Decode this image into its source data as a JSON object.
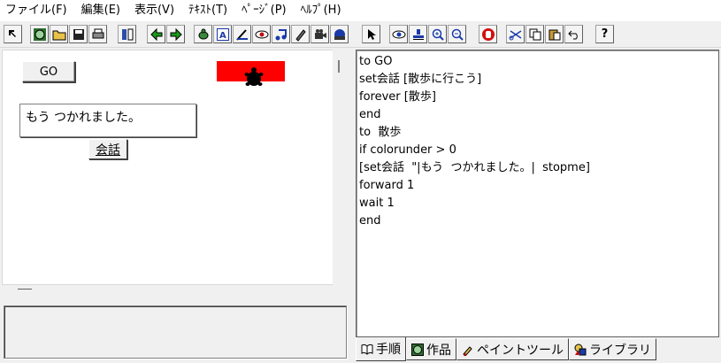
{
  "menu": {
    "items": [
      "ファイル(F)",
      "編集(E)",
      "表示(V)",
      "ﾃｷｽﾄ(T)",
      "ﾍﾟｰｼﾞ(P)",
      "ﾍﾙﾌﾟ(H)"
    ]
  },
  "toolbar": {
    "buttons": [
      {
        "name": "pointer-small-icon",
        "glyph": "⇱"
      },
      {
        "name": "globe-icon",
        "glyph": "◉"
      },
      {
        "name": "open-folder-icon",
        "glyph": "▭"
      },
      {
        "name": "save-disk-icon",
        "glyph": "▪"
      },
      {
        "name": "print-icon",
        "glyph": "▤"
      },
      {
        "name": "columns-icon",
        "glyph": "▥"
      },
      {
        "name": "arrow-left-icon",
        "glyph": "◀"
      },
      {
        "name": "arrow-right-icon",
        "glyph": "▶"
      },
      {
        "name": "turtle-icon",
        "glyph": "✿"
      },
      {
        "name": "text-box-icon",
        "glyph": "A"
      },
      {
        "name": "slider-icon",
        "glyph": "⚲"
      },
      {
        "name": "eye-button-icon",
        "glyph": "◉"
      },
      {
        "name": "music-note-icon",
        "glyph": "♫"
      },
      {
        "name": "pen-icon",
        "glyph": "✎"
      },
      {
        "name": "video-camera-icon",
        "glyph": "■"
      },
      {
        "name": "sphere-icon",
        "glyph": "●"
      },
      {
        "name": "select-arrow-icon",
        "glyph": "➚"
      },
      {
        "name": "eye-icon",
        "glyph": "◎"
      },
      {
        "name": "stamp-icon",
        "glyph": "⊥"
      },
      {
        "name": "zoom-in-icon",
        "glyph": "⊕"
      },
      {
        "name": "zoom-out-icon",
        "glyph": "⊖"
      },
      {
        "name": "stop-hand-icon",
        "glyph": "✋"
      },
      {
        "name": "cut-icon",
        "glyph": "✂"
      },
      {
        "name": "copy-icon",
        "glyph": "❐"
      },
      {
        "name": "paste-icon",
        "glyph": "▣"
      },
      {
        "name": "undo-icon",
        "glyph": "↶"
      },
      {
        "name": "help-icon",
        "glyph": "?"
      }
    ]
  },
  "canvas": {
    "go_button": "GO",
    "speech_text": "もう つかれました。",
    "kaiwa_button": "会話"
  },
  "code": {
    "lines": [
      "to GO",
      "set会話 [散歩に行こう]",
      "forever [散歩]",
      "end",
      "to  散歩",
      "if colorunder > 0",
      "[set会話  \"|もう  つかれました。|  stopme]",
      "forward 1",
      "wait 1",
      "end"
    ]
  },
  "tabs": [
    {
      "label": "手順",
      "icon": "book-icon",
      "active": true
    },
    {
      "label": "作品",
      "icon": "globe-icon",
      "active": false
    },
    {
      "label": "ペイントツール",
      "icon": "paintbrush-icon",
      "active": false
    },
    {
      "label": "ライブラリ",
      "icon": "shapes-icon",
      "active": false
    }
  ],
  "colors": {
    "red_shape": "#ff0000",
    "background": "#f0f0f0"
  }
}
